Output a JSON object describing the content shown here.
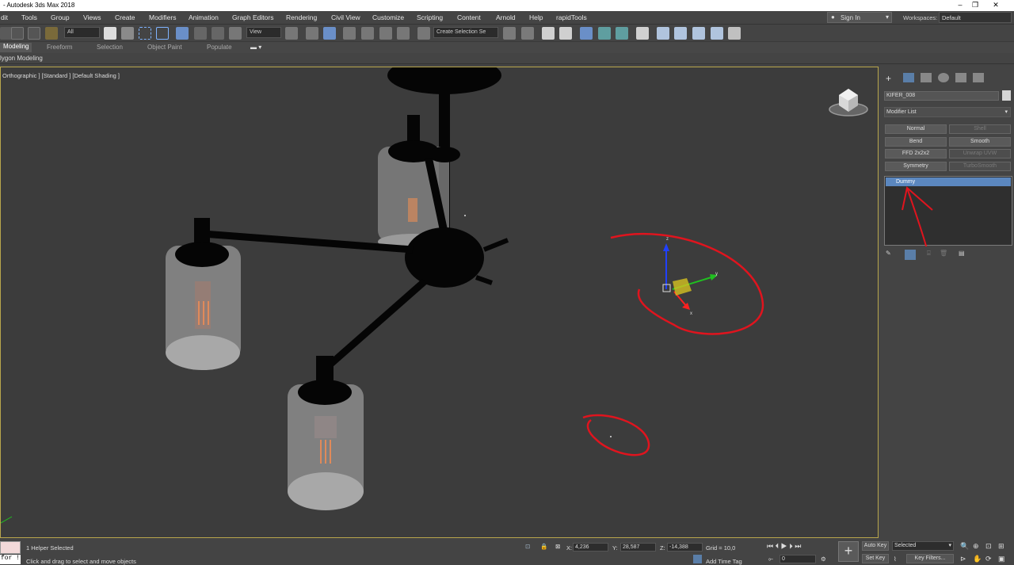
{
  "window": {
    "title": "- Autodesk 3ds Max 2018"
  },
  "menu": [
    "dit",
    "Tools",
    "Group",
    "Views",
    "Create",
    "Modifiers",
    "Animation",
    "Graph Editors",
    "Rendering",
    "Civil View",
    "Customize",
    "Scripting",
    "Content",
    "Arnold",
    "Help",
    "rapidTools"
  ],
  "account": {
    "sign_in": "Sign In",
    "workspaces_label": "Workspaces:",
    "workspace": "Default"
  },
  "toolbar": {
    "filter": "All",
    "ref_coord": "View",
    "selection_set": "Create Selection Se"
  },
  "ribbon": {
    "tabs": [
      "Modeling",
      "Freeform",
      "Selection",
      "Object Paint",
      "Populate"
    ],
    "sub": "lygon Modeling"
  },
  "viewport": {
    "label": "Orthographic ] [Standard ] [Default Shading ]",
    "gizmo_axes": {
      "x": "x",
      "y": "y",
      "z": "z"
    }
  },
  "command_panel": {
    "object_name": "KIFER_008",
    "modifier_list": "Modifier List",
    "modifier_buttons": [
      {
        "label": "Normal",
        "enabled": true
      },
      {
        "label": "Shell",
        "enabled": false
      },
      {
        "label": "Bend",
        "enabled": true
      },
      {
        "label": "Smooth",
        "enabled": true
      },
      {
        "label": "FFD 2x2x2",
        "enabled": true
      },
      {
        "label": "Unwrap UVW",
        "enabled": false
      },
      {
        "label": "Symmetry",
        "enabled": true
      },
      {
        "label": "TurboSmooth",
        "enabled": false
      }
    ],
    "stack_item": "Dummy"
  },
  "status": {
    "maxscript": "for !",
    "selection": "1 Helper Selected",
    "prompt": "Click and drag to select and move objects",
    "x_label": "X:",
    "x": "4,236",
    "y_label": "Y:",
    "y": "28,587",
    "z_label": "Z:",
    "z": "-14,388",
    "grid": "Grid = 10,0",
    "add_time_tag": "Add Time Tag",
    "auto_key": "Auto Key",
    "set_key": "Set Key",
    "key_mode": "Selected",
    "frame": "0",
    "key_filters": "Key Filters..."
  },
  "colors": {
    "viewport_bg": "#3c3c3c",
    "active_border": "#b8a64c",
    "stack_highlight": "#5b87bf",
    "annotation": "#e0141e"
  }
}
